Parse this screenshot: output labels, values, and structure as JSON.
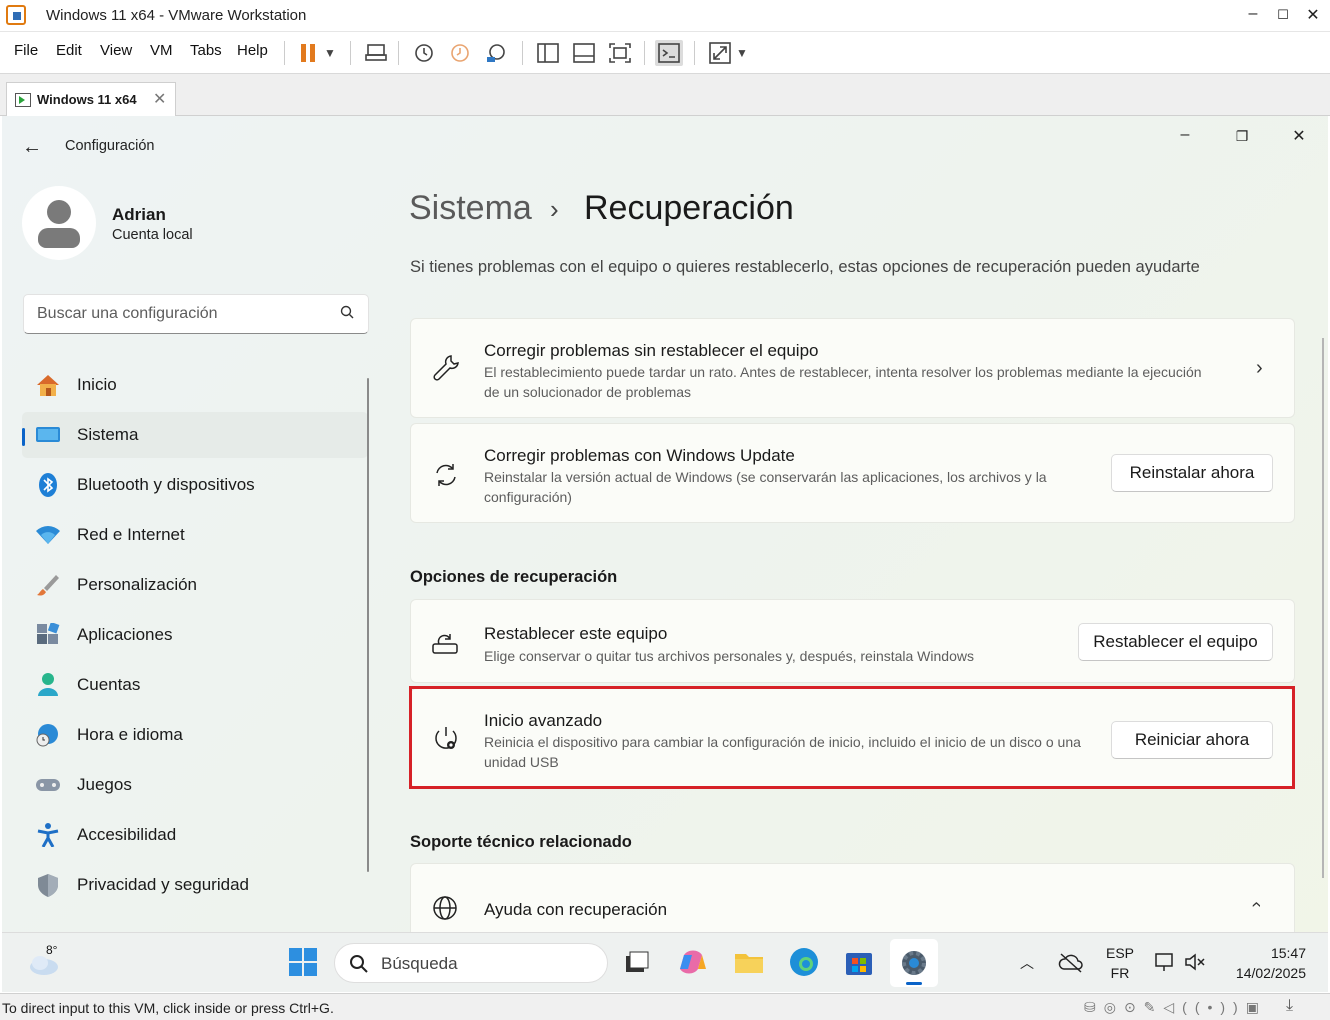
{
  "vmware": {
    "window_title": "Windows 11 x64 - VMware Workstation",
    "menu": [
      "File",
      "Edit",
      "View",
      "VM",
      "Tabs",
      "Help"
    ],
    "tab_label": "Windows 11 x64",
    "status_text": "To direct input to this VM, click inside or press Ctrl+G."
  },
  "settings": {
    "app_title": "Configuración",
    "user": {
      "name": "Adrian",
      "account_type": "Cuenta local"
    },
    "search_placeholder": "Buscar una configuración",
    "nav": [
      {
        "label": "Inicio",
        "icon": "home-icon"
      },
      {
        "label": "Sistema",
        "icon": "monitor-icon",
        "selected": true
      },
      {
        "label": "Bluetooth y dispositivos",
        "icon": "bluetooth-icon"
      },
      {
        "label": "Red e Internet",
        "icon": "wifi-icon"
      },
      {
        "label": "Personalización",
        "icon": "brush-icon"
      },
      {
        "label": "Aplicaciones",
        "icon": "apps-icon"
      },
      {
        "label": "Cuentas",
        "icon": "person-icon"
      },
      {
        "label": "Hora e idioma",
        "icon": "clock-globe-icon"
      },
      {
        "label": "Juegos",
        "icon": "gamepad-icon"
      },
      {
        "label": "Accesibilidad",
        "icon": "accessibility-icon"
      },
      {
        "label": "Privacidad y seguridad",
        "icon": "shield-icon"
      }
    ],
    "breadcrumb": {
      "parent": "Sistema",
      "separator": "›",
      "current": "Recuperación"
    },
    "description": "Si tienes problemas con el equipo o quieres restablecerlo, estas opciones de recuperación pueden ayudarte",
    "fix_cards": [
      {
        "title": "Corregir problemas sin restablecer el equipo",
        "subtitle": "El restablecimiento puede tardar un rato. Antes de restablecer, intenta resolver los problemas mediante la ejecución de un solucionador de problemas"
      },
      {
        "title": "Corregir problemas con Windows Update",
        "subtitle": "Reinstalar la versión actual de Windows (se conservarán las aplicaciones, los archivos y la configuración)",
        "button": "Reinstalar ahora"
      }
    ],
    "recovery_section": "Opciones de recuperación",
    "recovery_cards": [
      {
        "title": "Restablecer este equipo",
        "subtitle": "Elige conservar o quitar tus archivos personales y, después, reinstala Windows",
        "button": "Restablecer el equipo"
      },
      {
        "title": "Inicio avanzado",
        "subtitle": "Reinicia el dispositivo para cambiar la configuración de inicio, incluido el inicio de un disco o una unidad USB",
        "button": "Reiniciar ahora"
      }
    ],
    "support_section": "Soporte técnico relacionado",
    "support_card": {
      "title": "Ayuda con recuperación"
    }
  },
  "taskbar": {
    "weather": "8°",
    "search_placeholder": "Búsqueda",
    "lang_1": "ESP",
    "lang_2": "FR",
    "time": "15:47",
    "date": "14/02/2025"
  },
  "colors": {
    "highlight": "#d62127",
    "accent": "#0a63c8"
  }
}
